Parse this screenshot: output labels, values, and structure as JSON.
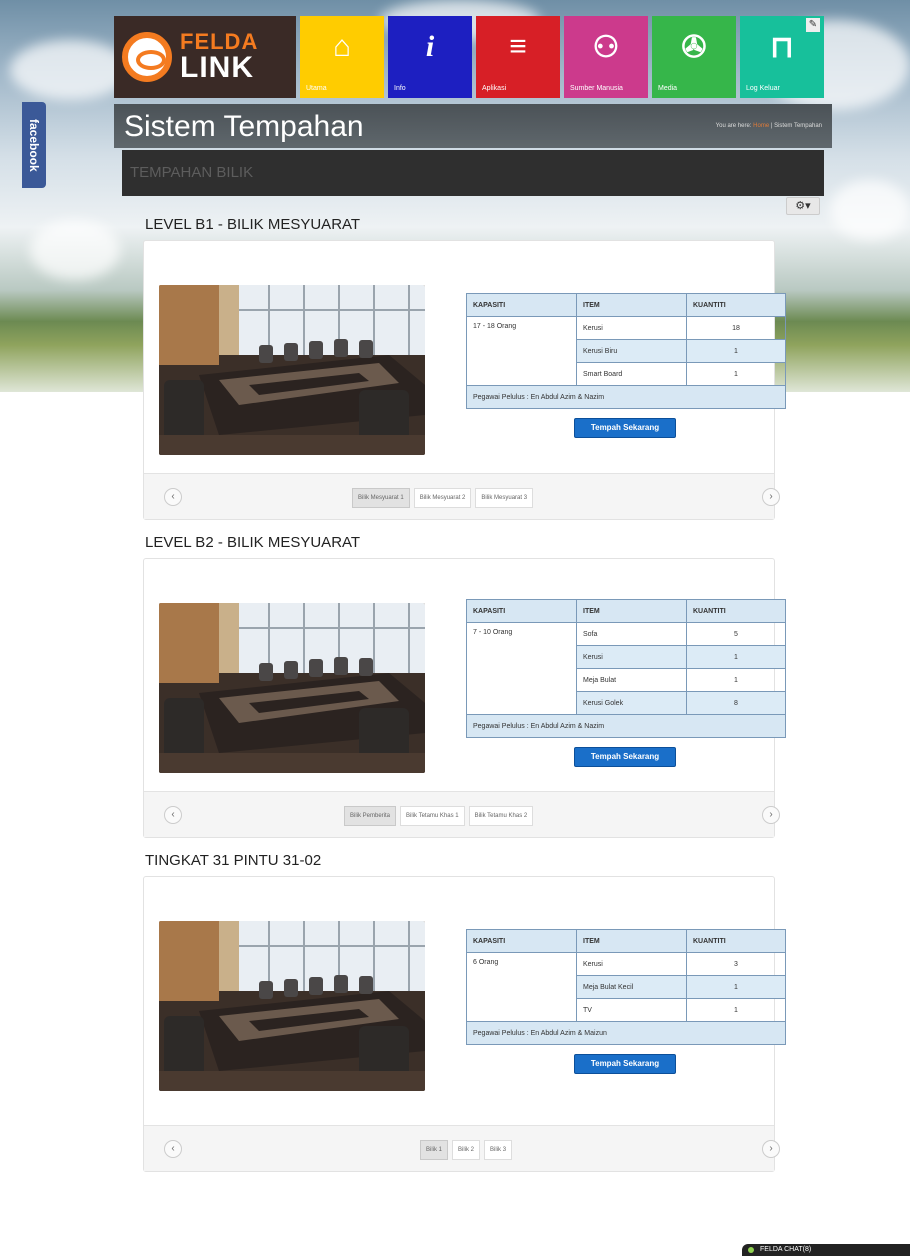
{
  "facebook_tab": "facebook",
  "logo": {
    "top": "FELDA",
    "bottom": "LINK"
  },
  "tiles": [
    {
      "label": "Utama",
      "icon": "home-icon",
      "glyph": "⌂",
      "color": "#ffcc00"
    },
    {
      "label": "Info",
      "icon": "info-icon",
      "glyph": "i",
      "color": "#1d1fc1"
    },
    {
      "label": "Aplikasi",
      "icon": "menu-icon",
      "glyph": "≡",
      "color": "#d71f26"
    },
    {
      "label": "Sumber Manusia",
      "icon": "people-icon",
      "glyph": "⚇",
      "color": "#cc3a8c"
    },
    {
      "label": "Media",
      "icon": "media-icon",
      "glyph": "✇",
      "color": "#36b64a"
    },
    {
      "label": "Log Keluar",
      "icon": "lock-icon",
      "glyph": "⊓",
      "color": "#17c09b"
    }
  ],
  "page_title": "Sistem Tempahan",
  "breadcrumb": {
    "prefix": "You are here:",
    "home": "Home",
    "current": "Sistem Tempahan"
  },
  "panel_heading": "TEMPAHAN BILIK",
  "gear_menu": "⚙▾",
  "table_headers": {
    "capacity": "KAPASITI",
    "item": "ITEM",
    "quantity": "KUANTITI"
  },
  "book_button": "Tempah Sekarang",
  "rooms": [
    {
      "title": "LEVEL B1 - BILIK MESYUARAT",
      "capacity": "17 - 18 Orang",
      "items": [
        {
          "name": "Kerusi",
          "qty": "18"
        },
        {
          "name": "Kerusi Biru",
          "qty": "1"
        },
        {
          "name": "Smart Board",
          "qty": "1"
        }
      ],
      "officer": "Pegawai Pelulus : En Abdul Azim & Nazim",
      "tabs": [
        "Bilik Mesyuarat 1",
        "Bilik Mesyuarat 2",
        "Bilik Mesyuarat 3"
      ]
    },
    {
      "title": "LEVEL B2 - BILIK MESYUARAT",
      "capacity": "7 - 10 Orang",
      "items": [
        {
          "name": "Sofa",
          "qty": "5"
        },
        {
          "name": "Kerusi",
          "qty": "1"
        },
        {
          "name": "Meja Bulat",
          "qty": "1"
        },
        {
          "name": "Kerusi Golek",
          "qty": "8"
        }
      ],
      "officer": "Pegawai Pelulus : En Abdul Azim & Nazim",
      "tabs": [
        "Bilik Pemberita",
        "Bilik Tetamu Khas 1",
        "Bilik Tetamu Khas 2"
      ]
    },
    {
      "title": "TINGKAT 31 PINTU 31-02",
      "capacity": "6 Orang",
      "items": [
        {
          "name": "Kerusi",
          "qty": "3"
        },
        {
          "name": "Meja Bulat Kecil",
          "qty": "1"
        },
        {
          "name": "TV",
          "qty": "1"
        }
      ],
      "officer": "Pegawai Pelulus : En Abdul Azim & Maizun",
      "tabs": [
        "Bilik 1",
        "Bilik 2",
        "Bilik 3"
      ]
    }
  ],
  "chat_bar": "FELDA CHAT(8)"
}
